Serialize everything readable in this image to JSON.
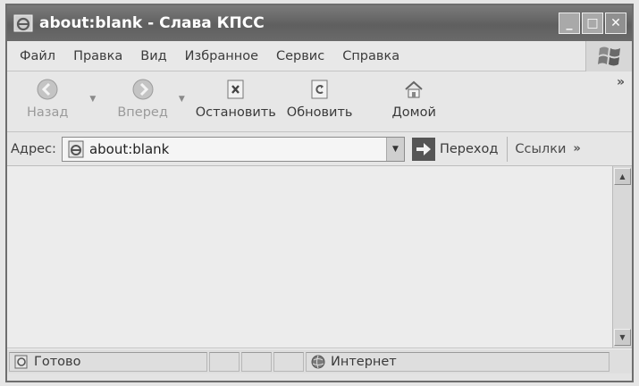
{
  "window": {
    "title": "about:blank - Слава КПСС",
    "controls": {
      "minimize": "_",
      "maximize": "□",
      "close": "✕"
    }
  },
  "menu": {
    "items": [
      "Файл",
      "Правка",
      "Вид",
      "Избранное",
      "Сервис",
      "Справка"
    ]
  },
  "toolbar": {
    "back_label": "Назад",
    "forward_label": "Вперед",
    "stop_label": "Остановить",
    "refresh_label": "Обновить",
    "home_label": "Домой",
    "more": "»"
  },
  "address": {
    "label": "Адрес:",
    "value": "about:blank",
    "go_label": "Переход",
    "links_label": "Ссылки",
    "links_more": "»"
  },
  "status": {
    "text": "Готово",
    "zone": "Интернет"
  },
  "icons": {
    "app": "ie-icon",
    "back": "back-arrow-icon",
    "forward": "forward-arrow-icon",
    "stop": "stop-icon",
    "refresh": "refresh-icon",
    "home": "home-icon",
    "go": "go-arrow-icon",
    "page": "page-icon",
    "zone": "globe-icon"
  }
}
